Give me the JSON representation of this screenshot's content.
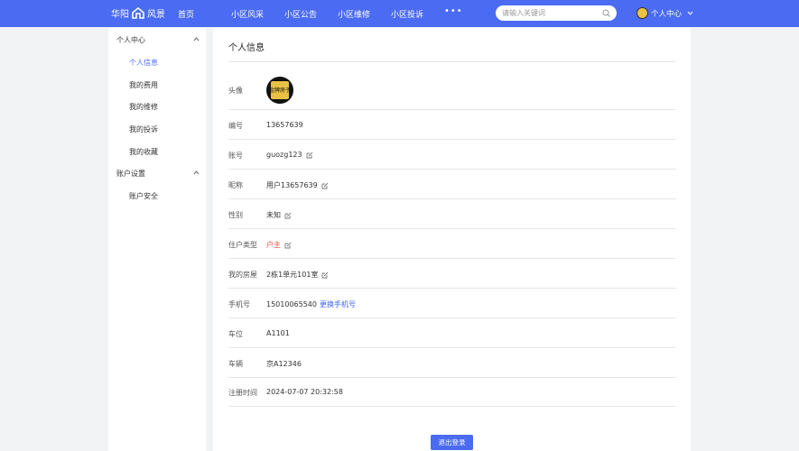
{
  "header": {
    "brand_left": "华阳",
    "brand_right": "风景",
    "nav": [
      "首页",
      "小区风采",
      "小区公告",
      "小区维修",
      "小区投诉"
    ],
    "more": "•••",
    "search_placeholder": "请输入关键词",
    "user_label": "个人中心",
    "accent_color": "#4a6bf2"
  },
  "sidebar": {
    "group1": "个人中心",
    "items1": [
      "个人信息",
      "我的费用",
      "我的维修",
      "我的投诉",
      "我的收藏"
    ],
    "group2": "账户设置",
    "items2": [
      "账户安全"
    ],
    "active": "个人信息"
  },
  "main": {
    "title": "个人信息",
    "avatar_label": "头像",
    "avatar_text": "金牌房子",
    "rows": [
      {
        "label": "编号",
        "value": "13657639"
      },
      {
        "label": "账号",
        "value": "guozg123"
      },
      {
        "label": "昵称",
        "value": "用户13657639"
      },
      {
        "label": "性别",
        "value": "未知"
      },
      {
        "label": "住户类型",
        "value": "户主"
      },
      {
        "label": "我的房屋",
        "value": "2栋1单元101室"
      },
      {
        "label": "手机号",
        "value": "15010065540",
        "link": "更换手机号"
      },
      {
        "label": "车位",
        "value": "A1101"
      },
      {
        "label": "车辆",
        "value": "京A12346"
      },
      {
        "label": "注册时间",
        "value": "2024-07-07 20:32:58"
      }
    ],
    "logout": "退出登录"
  }
}
